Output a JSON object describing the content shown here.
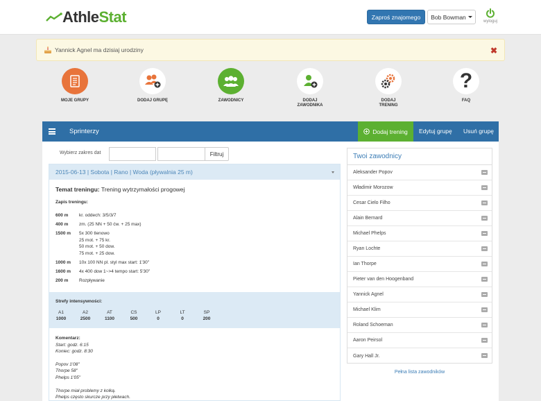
{
  "header": {
    "logo_prefix": "Athle",
    "logo_suffix": "Stat",
    "invite_label": "Zaproś znajomego",
    "user_name": "Bob Bowman",
    "logout_label": "wyloguj"
  },
  "alert": {
    "text": "Yannick Agnel ma dzisiaj urodziny"
  },
  "nav": {
    "my_groups": "MOJE GRUPY",
    "add_group": "DODAJ GRUPĘ",
    "athletes": "ZAWODNICY",
    "add_athlete_1": "DODAJ",
    "add_athlete_2": "ZAWODNIKA",
    "add_training_1": "DODAJ",
    "add_training_2": "TRENING",
    "faq": "FAQ"
  },
  "panel": {
    "group_name": "Sprinterzy",
    "add_training": "Dodaj trening",
    "edit_group": "Edytuj grupę",
    "delete_group": "Usuń grupę"
  },
  "filter": {
    "label": "Wybierz zakres dat",
    "button": "Filtruj"
  },
  "training": {
    "header": "2015-06-13 | Sobota | Rano | Woda (pływalnia 25 m)",
    "topic_label": "Temat treningu:",
    "topic_value": "Trening wytrzymałości progowej",
    "record_label": "Zapis treningu:",
    "records": [
      {
        "distance": "600 m",
        "lines": [
          "kr. oddech: 3/5/3/7"
        ]
      },
      {
        "distance": "400 m",
        "lines": [
          "zm. (25 NN + 50 ćw. + 25 max)"
        ]
      },
      {
        "distance": "1500 m",
        "lines": [
          "5x 300 tlenowo",
          "25 mot. + 75 kr.",
          "50 mot. + 50 dow.",
          "75 mot. + 25 dow."
        ]
      },
      {
        "distance": "1000 m",
        "lines": [
          "10x 100 NN pl. styl max start: 1'30\""
        ]
      },
      {
        "distance": "1600 m",
        "lines": [
          "4x 400 dow 1~>4 tempo start: 5'30\""
        ]
      },
      {
        "distance": "200 m",
        "lines": [
          "Rozpływanie"
        ]
      }
    ],
    "zones_title": "Strefy intensywności:",
    "zones": [
      {
        "name": "A1",
        "value": "1000"
      },
      {
        "name": "A2",
        "value": "2500"
      },
      {
        "name": "AT",
        "value": "1100"
      },
      {
        "name": "CS",
        "value": "500"
      },
      {
        "name": "LP",
        "value": "0"
      },
      {
        "name": "LT",
        "value": "0"
      },
      {
        "name": "SP",
        "value": "200"
      }
    ],
    "comment_title": "Komentarz:",
    "comment_lines": [
      "Start: godz. 6:15",
      "Koniec: godz. 8:30",
      "",
      "Popov 1'08\"",
      "Thorpe 58\"",
      "Phelps 1'05\"",
      "",
      "Thorpe miał problemy z kolką.",
      "Phelps często skurcze przy płetwach."
    ]
  },
  "athletes": {
    "title": "Twoi zawodnicy",
    "list": [
      "Aleksander Popov",
      "Władimir Morozow",
      "Cesar Cielo Filho",
      "Alain Bernard",
      "Michael Phelps",
      "Ryan Lochte",
      "Ian Thorpe",
      "Pieter van den Hoogenband",
      "Yannick Agnel",
      "Michael Klim",
      "Roland Schoeman",
      "Aaron Peirsol",
      "Gary Hall Jr."
    ],
    "full_list_link": "Pełna lista zawodników"
  },
  "colors": {
    "brand_green": "#5cb031",
    "brand_blue": "#2f6fa6",
    "orange": "#e8743b"
  }
}
